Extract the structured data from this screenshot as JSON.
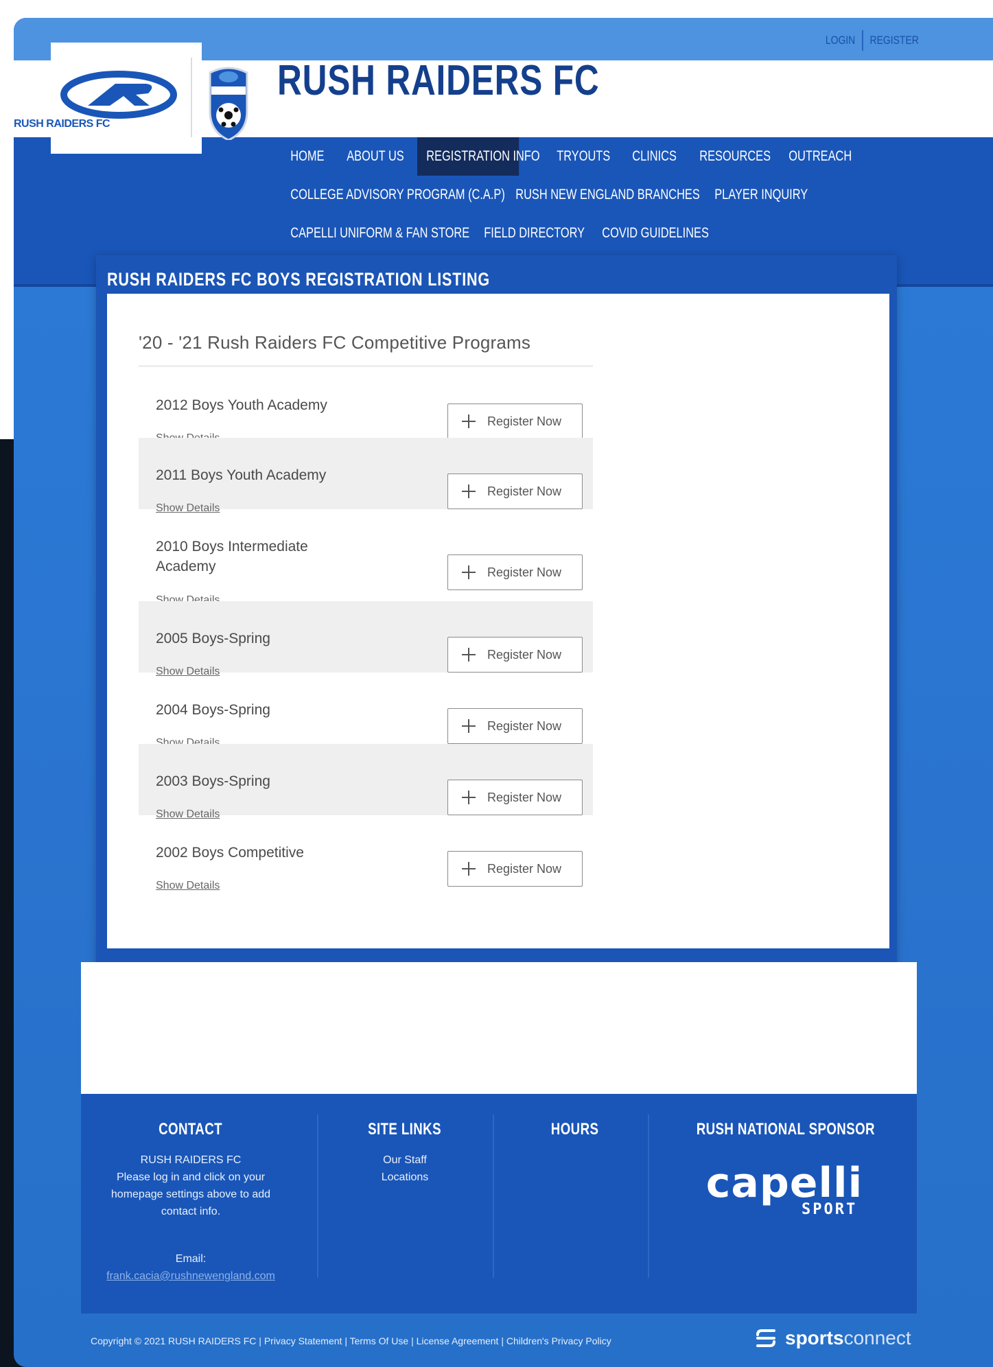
{
  "utility": {
    "login": "LOGIN",
    "register": "REGISTER"
  },
  "logo": {
    "club_name": "RUSH RAIDERS FC"
  },
  "header": {
    "title": "RUSH RAIDERS FC"
  },
  "nav": {
    "row1": [
      {
        "label": "HOME"
      },
      {
        "label": "ABOUT US"
      },
      {
        "label": "REGISTRATION INFO",
        "active": true
      },
      {
        "label": "TRYOUTS"
      },
      {
        "label": "CLINICS"
      },
      {
        "label": "RESOURCES"
      },
      {
        "label": "OUTREACH"
      }
    ],
    "row2": [
      {
        "label": "COLLEGE ADVISORY PROGRAM (C.A.P)"
      },
      {
        "label": "RUSH NEW ENGLAND BRANCHES"
      },
      {
        "label": "PLAYER INQUIRY"
      }
    ],
    "row3": [
      {
        "label": "CAPELLI UNIFORM & FAN STORE"
      },
      {
        "label": "FIELD DIRECTORY"
      },
      {
        "label": "COVID GUIDELINES"
      }
    ]
  },
  "listing": {
    "title": "RUSH RAIDERS FC BOYS REGISTRATION LISTING",
    "group_title": "'20 - '21 Rush Raiders FC Competitive Programs",
    "items": [
      {
        "name": "2012 Boys Youth Academy",
        "details": "Show Details",
        "button": "Register Now"
      },
      {
        "name": "2011 Boys Youth Academy",
        "details": "Show Details",
        "button": "Register Now"
      },
      {
        "name": "2010 Boys Intermediate Academy",
        "details": "Show Details",
        "button": "Register Now"
      },
      {
        "name": "2005 Boys-Spring",
        "details": "Show Details",
        "button": "Register Now"
      },
      {
        "name": "2004 Boys-Spring",
        "details": "Show Details",
        "button": "Register Now"
      },
      {
        "name": "2003 Boys-Spring",
        "details": "Show Details",
        "button": "Register Now"
      },
      {
        "name": "2002 Boys Competitive",
        "details": "Show Details",
        "button": "Register Now"
      }
    ]
  },
  "footer": {
    "contact": {
      "heading": "CONTACT",
      "club": "RUSH RAIDERS FC",
      "message": "Please log in and click on your homepage settings above to add contact info.",
      "email_label": "Email:",
      "email": "frank.cacia@rushnewengland.com"
    },
    "site_links": {
      "heading": "SITE LINKS",
      "links": [
        "Our Staff",
        "Locations"
      ]
    },
    "hours": {
      "heading": "HOURS"
    },
    "sponsor": {
      "heading": "RUSH NATIONAL SPONSOR",
      "logo_text": "capelli",
      "logo_sub": "SPORT"
    }
  },
  "copyright": {
    "text": "Copyright © 2021 RUSH RAIDERS FC",
    "links": [
      "Privacy Statement",
      "Terms Of Use",
      "License Agreement",
      "Children's Privacy Policy"
    ]
  },
  "powered_by": {
    "bold": "sports",
    "light": "connect"
  },
  "colors": {
    "nav_blue": "#1a56b8",
    "active_nav": "#142c5c",
    "title_blue": "#143f8c"
  }
}
